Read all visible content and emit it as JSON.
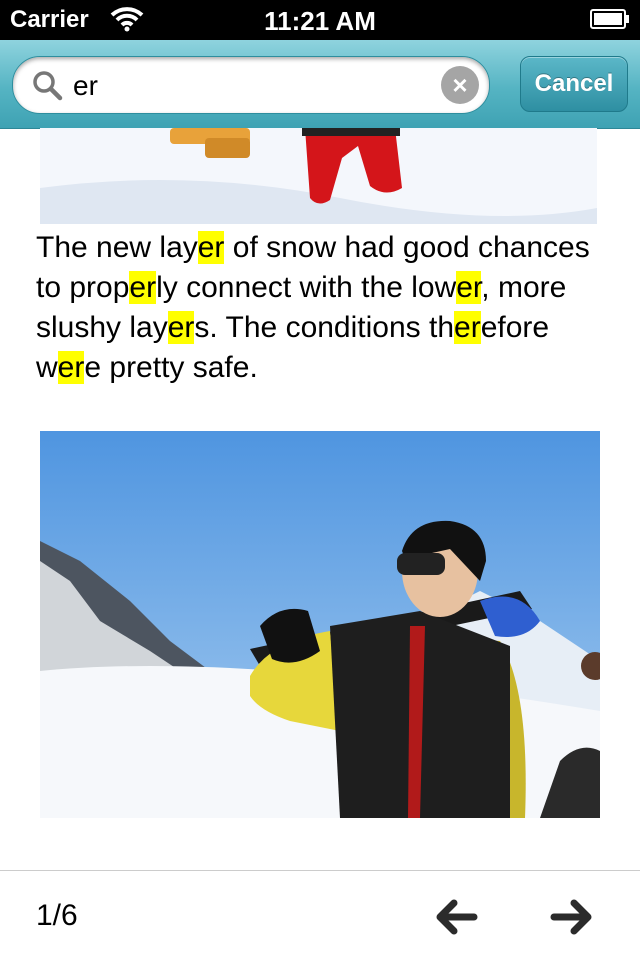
{
  "status_bar": {
    "carrier": "Carrier",
    "time": "11:21 AM"
  },
  "search": {
    "value": "er",
    "cancel_label": "Cancel"
  },
  "article": {
    "paragraph_segments": [
      {
        "text": "The new lay",
        "highlight": false
      },
      {
        "text": "er",
        "highlight": true
      },
      {
        "text": " of snow had good chances to prop",
        "highlight": false
      },
      {
        "text": "er",
        "highlight": true
      },
      {
        "text": "ly connect with the low",
        "highlight": false
      },
      {
        "text": "er",
        "highlight": true
      },
      {
        "text": ", more slushy lay",
        "highlight": false
      },
      {
        "text": "er",
        "highlight": true
      },
      {
        "text": "s. The conditions th",
        "highlight": false
      },
      {
        "text": "er",
        "highlight": true
      },
      {
        "text": "efore w",
        "highlight": false
      },
      {
        "text": "er",
        "highlight": true
      },
      {
        "text": "e pretty safe.",
        "highlight": false
      }
    ],
    "highlight_color": "#ffff00"
  },
  "toolbar": {
    "page_counter": "1/6",
    "prev_icon": "arrow-left-icon",
    "next_icon": "arrow-right-icon"
  },
  "colors": {
    "search_bar_accent": "#55b4c3",
    "cancel_button": "#2e8fa2"
  }
}
